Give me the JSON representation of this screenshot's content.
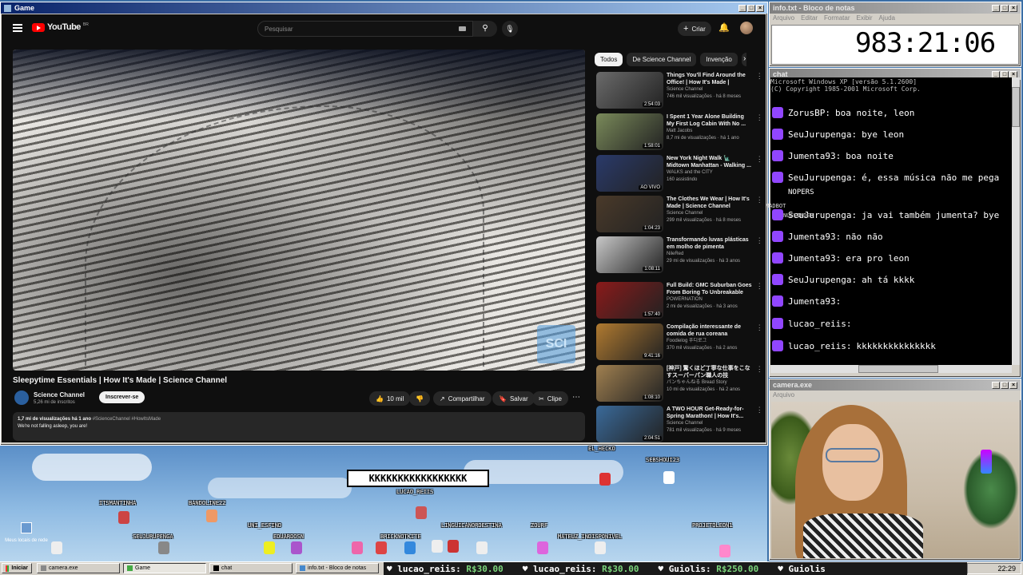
{
  "game_window": {
    "title": "Game"
  },
  "youtube": {
    "logo_text": "YouTube",
    "region": "BR",
    "search_placeholder": "Pesquisar",
    "create_label": "Criar",
    "chips": [
      "Todos",
      "De Science Channel",
      "Invenção",
      "Re"
    ],
    "video_title": "Sleepytime Essentials | How It's Made | Science Channel",
    "channel": "Science Channel",
    "subscribers": "5,26 mi de inscritos",
    "subscribe_label": "Inscrever-se",
    "likes": "10 mil",
    "share_label": "Compartilhar",
    "save_label": "Salvar",
    "clip_label": "Clipe",
    "views_line": "1,7 mi de visualizações  há 1 ano",
    "hashtags": "#ScienceChannel #HowItsMade",
    "description": "We're not falling asleep, you are!",
    "watermark": "SCI",
    "recommendations": [
      {
        "title": "Things You'll Find Around the Office! | How It's Made | Science...",
        "channel": "Science Channel",
        "meta": "746 mil visualizações · há 8 meses",
        "duration": "2:54:03",
        "color": "#6b6b6b"
      },
      {
        "title": "I Spent 1 Year Alone Building My First Log Cabin With No ...",
        "channel": "Matt Jacobs",
        "meta": "8,7 mi de visualizações · há 1 ano",
        "duration": "1:58:01",
        "color": "#7a8a5a"
      },
      {
        "title": "New York Night Walk 🗽 Midtown Manhattan - Walking ...",
        "channel": "WALKS and the CITY",
        "meta": "160 assistindo",
        "duration": "AO VIVO",
        "color": "#2a3a6a"
      },
      {
        "title": "The Clothes We Wear | How It's Made | Science Channel",
        "channel": "Science Channel",
        "meta": "299 mil visualizações · há 8 meses",
        "duration": "1:04:23",
        "color": "#4a3a2a"
      },
      {
        "title": "Transformando luvas plásticas em molho de pimenta",
        "channel": "NileRed",
        "meta": "29 mi de visualizações · há 3 anos",
        "duration": "1:08:11",
        "color": "#c8c8c8"
      },
      {
        "title": "Full Build: GMC Suburban Goes From Boring To Unbreakable",
        "channel": "POWERNATION",
        "meta": "2 mi de visualizações · há 3 anos",
        "duration": "1:57:40",
        "color": "#8a1a1a"
      },
      {
        "title": "Compilação interessante de comida de rua coreana",
        "channel": "Foodielog 푸디로그",
        "meta": "370 mil visualizações · há 2 anos",
        "duration": "9:41:16",
        "color": "#b07a30"
      },
      {
        "title": "[神戸] 驚くほど丁寧な仕事をこなすスーパーパン職人の技",
        "channel": "パンちゃんねる Bread Story",
        "meta": "10 mi de visualizações · há 2 anos",
        "duration": "1:08:10",
        "color": "#a08050"
      },
      {
        "title": "A TWO HOUR Get-Ready-for-Spring Marathon! | How It's...",
        "channel": "Science Channel",
        "meta": "781 mil visualizações · há 9 meses",
        "duration": "2:04:51",
        "color": "#3a6a9a"
      }
    ]
  },
  "notepad": {
    "title": "info.txt - Bloco de notas",
    "menu": [
      "Arquivo",
      "Editar",
      "Formatar",
      "Exibir",
      "Ajuda"
    ],
    "timer": "983:21:06"
  },
  "chat_window": {
    "title": "chat",
    "header_lines": [
      "Microsoft Windows XP [versão 5.1.2600]",
      "(C) Copyright 1985-2001 Microsoft Corp."
    ],
    "lines": [
      {
        "user": "ZorusBP:",
        "text": "boa noite, leon"
      },
      {
        "user": "SeuJurupenga:",
        "text": "bye leon"
      },
      {
        "user": "Jumenta93:",
        "text": "boa noite"
      },
      {
        "user": "SeuJurupenga:",
        "text": "é, essa música não me pega"
      },
      {
        "user": "",
        "text": "NOPERS"
      },
      {
        "user": "SeuJurupenga:",
        "text": "ja vai também jumenta? bye"
      },
      {
        "user": "Jumenta93:",
        "text": "não não"
      },
      {
        "user": "Jumenta93:",
        "text": "era pro leon"
      },
      {
        "user": "SeuJurupenga:",
        "text": "ah tá kkkk"
      },
      {
        "user": "Jumenta93:",
        "text": ""
      },
      {
        "user": "lucao_reiis:",
        "text": ""
      },
      {
        "user": "lucao_reiis:",
        "text": "kkkkkkkkkkkkkkk"
      }
    ],
    "overlay_names": [
      "MADBOT",
      "NUELINDER"
    ]
  },
  "camera_window": {
    "title": "camera.exe",
    "menu": [
      "Arquivo"
    ]
  },
  "game": {
    "speech_bubble": "KKKKKKKKKKKKKKKKK",
    "usernames": [
      "EL_HECKO",
      "SEBSHOUI23",
      "LUCAO_REIIS",
      "ITSMANTINHA",
      "BANDOLINE22",
      "UNI_ESFIND",
      "SEUJURUPENGA",
      "EDUARDOSN",
      "BRICKNOTKITE",
      "LINGUICANORDESTINA",
      "ZOURF",
      "MATEUZ_INDISPONIVEL",
      "PROJETOLEON1"
    ],
    "desktop_icon_label": "Meus locais de rede"
  },
  "taskbar": {
    "start_label": "Iniciar",
    "buttons": [
      "camera.exe",
      "Game",
      "chat",
      "info.txt - Bloco de notas"
    ],
    "ticker": [
      {
        "user": "lucao_reiis:",
        "amount": "R$30.00"
      },
      {
        "user": "lucao_reiis:",
        "amount": "R$30.00"
      },
      {
        "user": "Guiolis:",
        "amount": "R$250.00"
      },
      {
        "user": "Guiolis",
        "amount": ""
      }
    ],
    "clock": "22:29"
  },
  "colors": {
    "yt_bg": "#0f0f0f",
    "xp_title": "#0a246a",
    "chat_badge": "#9146ff",
    "sky": "#8ab8e0"
  }
}
